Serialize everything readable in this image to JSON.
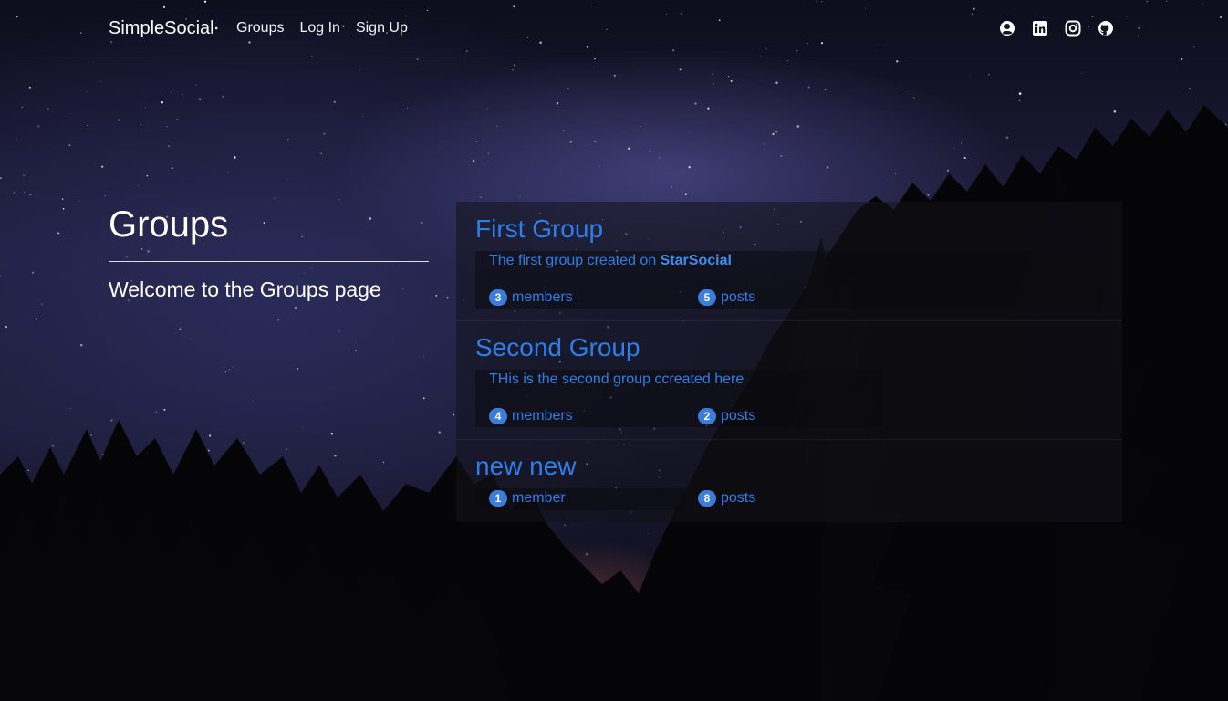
{
  "nav": {
    "brand": "SimpleSocial",
    "links": [
      "Groups",
      "Log In",
      "Sign Up"
    ],
    "icons": [
      "user-circle-icon",
      "linkedin-icon",
      "instagram-icon",
      "github-icon"
    ]
  },
  "header": {
    "title": "Groups",
    "subtitle": "Welcome to the Groups page"
  },
  "groups": [
    {
      "name": "First Group",
      "description": "The first group created on ",
      "description_bold": "StarSocial",
      "members_count": "3",
      "members_label": "members",
      "posts_count": "5",
      "posts_label": "posts"
    },
    {
      "name": "Second Group",
      "description": "THis is the second group ccreated here",
      "description_bold": "",
      "members_count": "4",
      "members_label": "members",
      "posts_count": "2",
      "posts_label": "posts"
    },
    {
      "name": "new new",
      "description": "",
      "description_bold": "",
      "members_count": "1",
      "members_label": "member",
      "posts_count": "8",
      "posts_label": "posts"
    }
  ],
  "colors": {
    "link": "#2d7ee8",
    "badge": "#3b7ddd",
    "background": "#1e1e3c"
  }
}
